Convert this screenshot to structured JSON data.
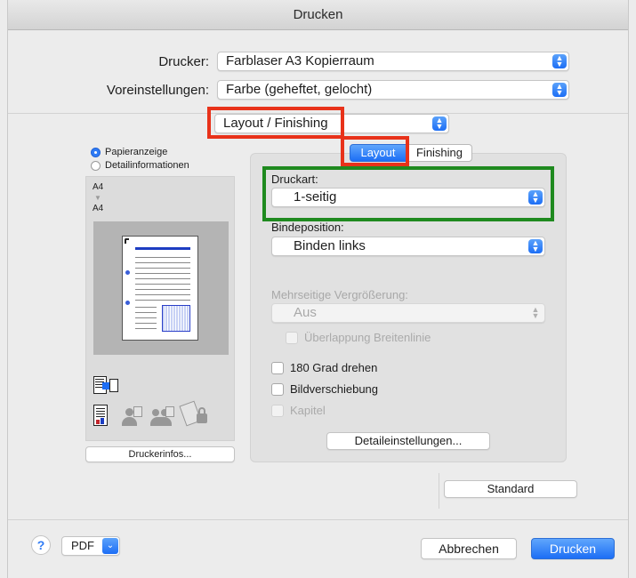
{
  "window": {
    "title": "Drucken"
  },
  "printer": {
    "label": "Drucker:",
    "value": "Farblaser A3 Kopierraum"
  },
  "presets": {
    "label": "Voreinstellungen:",
    "value": "Farbe (geheftet, gelocht)"
  },
  "section_menu": {
    "value": "Layout / Finishing"
  },
  "sidebar": {
    "radio_paper": "Papieranzeige",
    "radio_details": "Detailinformationen",
    "paper_size_top": "A4",
    "paper_size_bottom": "A4",
    "printer_info_button": "Druckerinfos..."
  },
  "tabs": {
    "layout": "Layout",
    "finishing": "Finishing"
  },
  "druckart": {
    "label": "Druckart:",
    "value": "1-seitig"
  },
  "bindeposition": {
    "label": "Bindeposition:",
    "value": "Binden links"
  },
  "enlargement": {
    "label": "Mehrseitige Vergrößerung:",
    "value": "Aus",
    "overlap_label": "Überlappung Breitenlinie"
  },
  "checkboxes": {
    "rotate": "180 Grad drehen",
    "image_shift": "Bildverschiebung",
    "chapter": "Kapitel"
  },
  "buttons": {
    "detail_settings": "Detaileinstellungen...",
    "standard": "Standard",
    "pdf": "PDF",
    "cancel": "Abbrechen",
    "print": "Drucken",
    "help": "?"
  },
  "colors": {
    "accent": "#1c6ef5",
    "highlight_red": "#e8321a",
    "highlight_green": "#1f8a1f"
  },
  "icons": [
    "help-icon",
    "chevron-down-icon",
    "up-down-stepper-icon",
    "printer-job-icon",
    "document-icon",
    "user-icon",
    "users-icon",
    "lock-icon"
  ]
}
